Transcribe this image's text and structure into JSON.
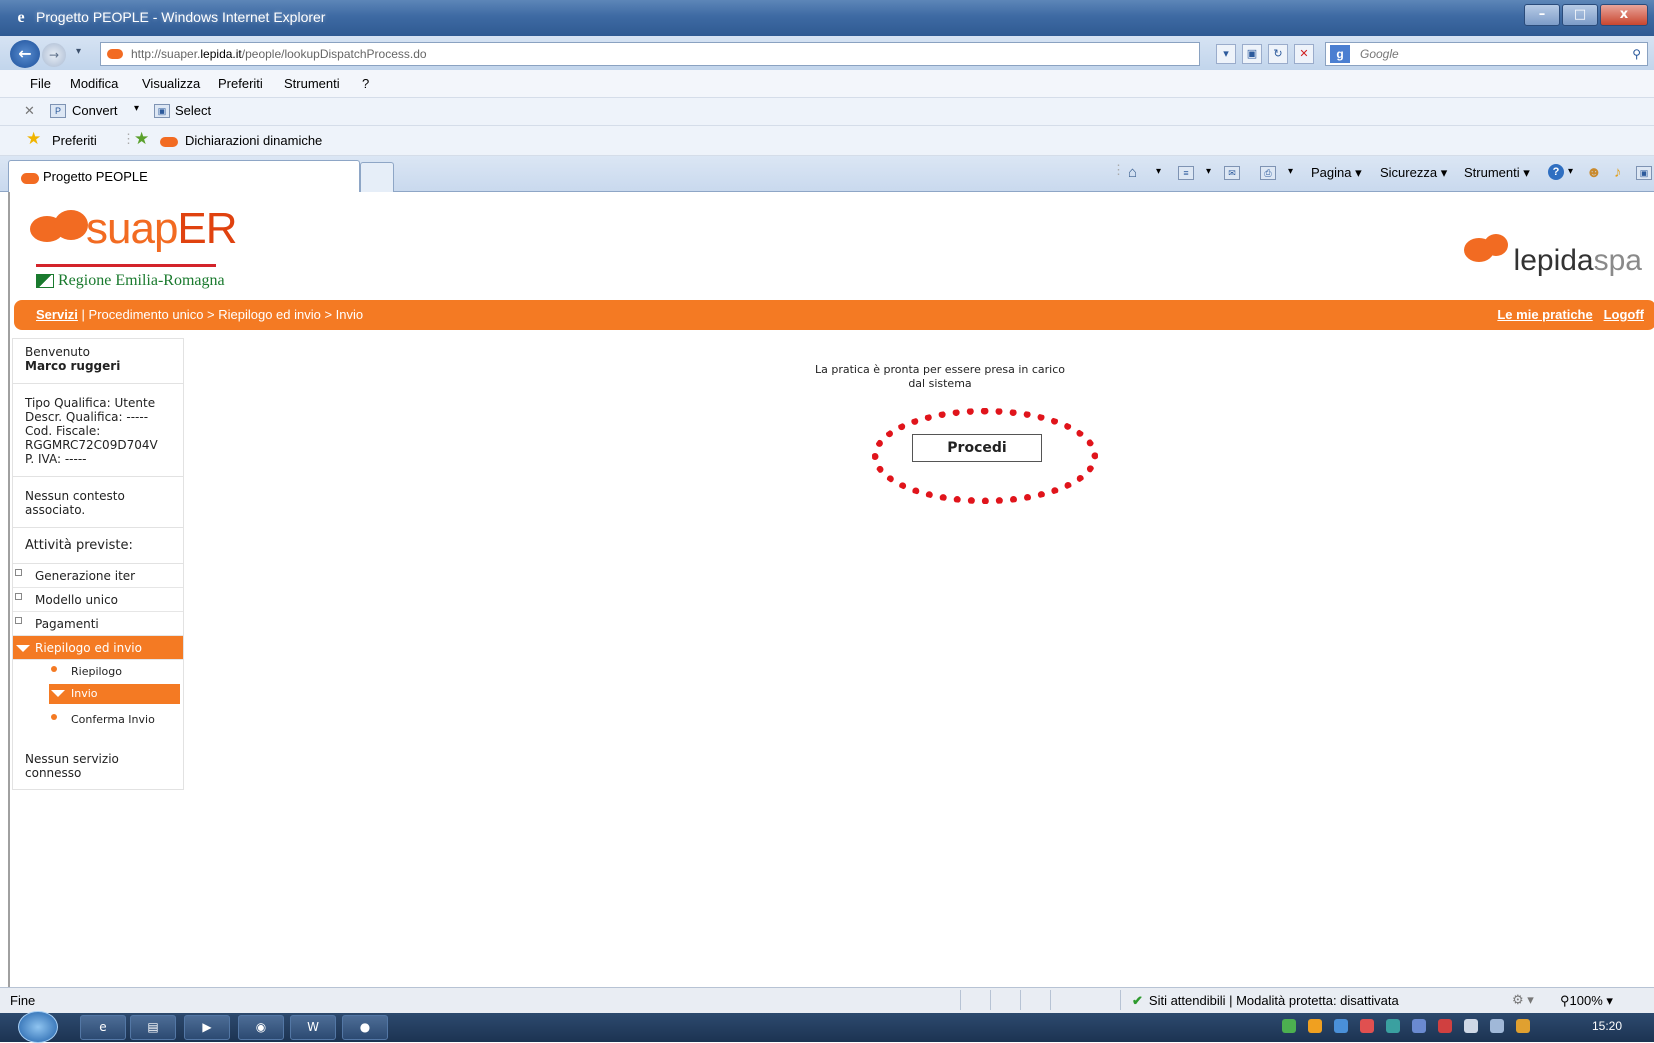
{
  "window": {
    "title": "Progetto PEOPLE - Windows Internet Explorer",
    "minimize": "–",
    "maximize": "□",
    "close": "x"
  },
  "address": {
    "url_prefix": "http://suaper.",
    "url_host": "lepida.it",
    "url_path": "/people/lookupDispatchProcess.do",
    "search_placeholder": "Google"
  },
  "menu": [
    "File",
    "Modifica",
    "Visualizza",
    "Preferiti",
    "Strumenti",
    "?"
  ],
  "commandbar": {
    "convert": "Convert",
    "select": "Select"
  },
  "favorites": {
    "label": "Preferiti",
    "item": "Dichiarazioni dinamiche"
  },
  "tabs": {
    "active": "Progetto PEOPLE"
  },
  "tab_tools": {
    "pagina": "Pagina ▾",
    "sicurezza": "Sicurezza ▾",
    "strumenti": "Strumenti ▾"
  },
  "header": {
    "suap": "suap",
    "er": "ER",
    "region": "Regione Emilia-Romagna",
    "lepida": "lepida",
    "spa": "spa"
  },
  "breadcrumb": {
    "servizi": "Servizi",
    "trail": " | Procedimento unico > Riepilogo ed invio > Invio",
    "le_mie_pratiche": "Le mie pratiche",
    "logoff": "Logoff"
  },
  "sidebar": {
    "welcome": "Benvenuto",
    "user": "Marco ruggeri",
    "tipo": "Tipo Qualifica: Utente",
    "descr": "Descr. Qualifica: -----",
    "codfisc_label": "Cod. Fiscale:",
    "codfisc": "RGGMRC72C09D704V",
    "piva": "P. IVA: -----",
    "contesto": "Nessun contesto associato.",
    "attivita": "Attività previste:",
    "items": [
      "Generazione iter",
      "Modello unico",
      "Pagamenti"
    ],
    "active_item": "Riepilogo ed invio",
    "sub_items": [
      "Riepilogo",
      "Invio",
      "Conferma Invio"
    ],
    "servizio": "Nessun servizio connesso"
  },
  "main": {
    "message_line1": "La pratica è pronta per essere presa in carico",
    "message_line2": "dal sistema",
    "procedi": "Procedi"
  },
  "status": {
    "left": "Fine",
    "zone": "Siti attendibili | Modalità protetta: disattivata",
    "zoom": "100%"
  },
  "taskbar": {
    "clock": "15:20"
  }
}
